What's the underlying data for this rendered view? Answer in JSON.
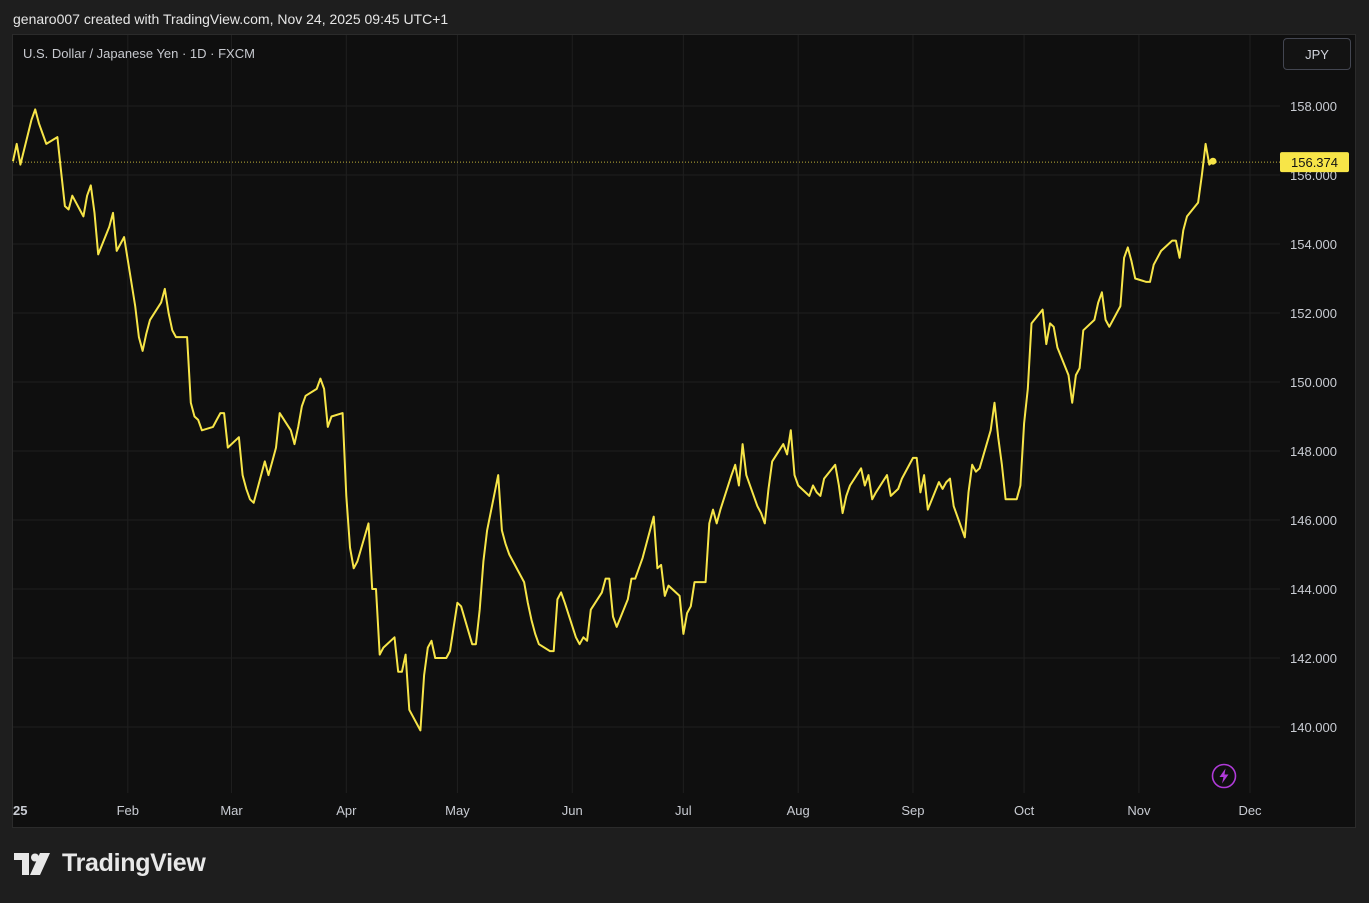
{
  "header": {
    "attribution": "genaro007 created with TradingView.com, Nov 24, 2025 09:45 UTC+1"
  },
  "toolbar": {
    "symbol_title": "U.S. Dollar / Japanese Yen · 1D · FXCM",
    "currency_button": "JPY"
  },
  "footer": {
    "logo_text": "TradingView",
    "logo_icon": "tradingview-logo-icon"
  },
  "icons": {
    "lightning": "lightning-icon"
  },
  "colors": {
    "line": "#f7e548",
    "background": "#0f0f0f",
    "outer_background": "#1e1e1e",
    "price_tag": "#f7e548",
    "lightning": "#b03bd9"
  },
  "chart_data": {
    "type": "line",
    "title": "",
    "xlabel": "",
    "ylabel": "",
    "ylim": [
      138.2,
      160.3
    ],
    "yticks": [
      "158.000",
      "156.000",
      "154.000",
      "152.000",
      "150.000",
      "148.000",
      "146.000",
      "144.000",
      "142.000",
      "140.000"
    ],
    "ytick_values": [
      158,
      156,
      154,
      152,
      150,
      148,
      146,
      144,
      142,
      140
    ],
    "xticks": [
      {
        "label": "25",
        "date": "2025-01-01",
        "bold": true
      },
      {
        "label": "Feb",
        "date": "2025-02-01"
      },
      {
        "label": "Mar",
        "date": "2025-03-01"
      },
      {
        "label": "Apr",
        "date": "2025-04-01"
      },
      {
        "label": "May",
        "date": "2025-05-01"
      },
      {
        "label": "Jun",
        "date": "2025-06-01"
      },
      {
        "label": "Jul",
        "date": "2025-07-01"
      },
      {
        "label": "Aug",
        "date": "2025-08-01"
      },
      {
        "label": "Sep",
        "date": "2025-09-01"
      },
      {
        "label": "Oct",
        "date": "2025-10-01"
      },
      {
        "label": "Nov",
        "date": "2025-11-01"
      },
      {
        "label": "Dec",
        "date": "2025-12-01"
      }
    ],
    "last_price": 156.374,
    "last_price_label": "156.374",
    "grid": true,
    "series": [
      {
        "values": [
          [
            "2025-01-01",
            156.4
          ],
          [
            "2025-01-02",
            156.9
          ],
          [
            "2025-01-03",
            156.3
          ],
          [
            "2025-01-06",
            157.6
          ],
          [
            "2025-01-07",
            157.9
          ],
          [
            "2025-01-08",
            157.5
          ],
          [
            "2025-01-09",
            157.2
          ],
          [
            "2025-01-10",
            156.9
          ],
          [
            "2025-01-13",
            157.1
          ],
          [
            "2025-01-14",
            156.1
          ],
          [
            "2025-01-15",
            155.1
          ],
          [
            "2025-01-16",
            155.0
          ],
          [
            "2025-01-17",
            155.4
          ],
          [
            "2025-01-20",
            154.8
          ],
          [
            "2025-01-21",
            155.4
          ],
          [
            "2025-01-22",
            155.7
          ],
          [
            "2025-01-23",
            154.9
          ],
          [
            "2025-01-24",
            153.7
          ],
          [
            "2025-01-27",
            154.5
          ],
          [
            "2025-01-28",
            154.9
          ],
          [
            "2025-01-29",
            153.8
          ],
          [
            "2025-01-30",
            154.0
          ],
          [
            "2025-01-31",
            154.2
          ],
          [
            "2025-02-03",
            152.2
          ],
          [
            "2025-02-04",
            151.3
          ],
          [
            "2025-02-05",
            150.9
          ],
          [
            "2025-02-06",
            151.4
          ],
          [
            "2025-02-07",
            151.8
          ],
          [
            "2025-02-10",
            152.3
          ],
          [
            "2025-02-11",
            152.7
          ],
          [
            "2025-02-12",
            152.0
          ],
          [
            "2025-02-13",
            151.5
          ],
          [
            "2025-02-14",
            151.3
          ],
          [
            "2025-02-17",
            151.3
          ],
          [
            "2025-02-18",
            149.4
          ],
          [
            "2025-02-19",
            149.0
          ],
          [
            "2025-02-20",
            148.9
          ],
          [
            "2025-02-21",
            148.6
          ],
          [
            "2025-02-24",
            148.7
          ],
          [
            "2025-02-25",
            148.9
          ],
          [
            "2025-02-26",
            149.1
          ],
          [
            "2025-02-27",
            149.1
          ],
          [
            "2025-02-28",
            148.1
          ],
          [
            "2025-03-03",
            148.4
          ],
          [
            "2025-03-04",
            147.3
          ],
          [
            "2025-03-05",
            146.9
          ],
          [
            "2025-03-06",
            146.6
          ],
          [
            "2025-03-07",
            146.5
          ],
          [
            "2025-03-10",
            147.7
          ],
          [
            "2025-03-11",
            147.3
          ],
          [
            "2025-03-12",
            147.7
          ],
          [
            "2025-03-13",
            148.1
          ],
          [
            "2025-03-14",
            149.1
          ],
          [
            "2025-03-17",
            148.6
          ],
          [
            "2025-03-18",
            148.2
          ],
          [
            "2025-03-19",
            148.7
          ],
          [
            "2025-03-20",
            149.3
          ],
          [
            "2025-03-21",
            149.6
          ],
          [
            "2025-03-24",
            149.8
          ],
          [
            "2025-03-25",
            150.1
          ],
          [
            "2025-03-26",
            149.8
          ],
          [
            "2025-03-27",
            148.7
          ],
          [
            "2025-03-28",
            149.0
          ],
          [
            "2025-03-31",
            149.1
          ],
          [
            "2025-04-01",
            146.7
          ],
          [
            "2025-04-02",
            145.2
          ],
          [
            "2025-04-03",
            144.6
          ],
          [
            "2025-04-04",
            144.8
          ],
          [
            "2025-04-07",
            145.9
          ],
          [
            "2025-04-08",
            144.0
          ],
          [
            "2025-04-09",
            144.0
          ],
          [
            "2025-04-10",
            142.1
          ],
          [
            "2025-04-11",
            142.3
          ],
          [
            "2025-04-14",
            142.6
          ],
          [
            "2025-04-15",
            141.6
          ],
          [
            "2025-04-16",
            141.6
          ],
          [
            "2025-04-17",
            142.1
          ],
          [
            "2025-04-18",
            140.5
          ],
          [
            "2025-04-21",
            139.9
          ],
          [
            "2025-04-22",
            141.5
          ],
          [
            "2025-04-23",
            142.3
          ],
          [
            "2025-04-24",
            142.5
          ],
          [
            "2025-04-25",
            142.0
          ],
          [
            "2025-04-28",
            142.0
          ],
          [
            "2025-04-29",
            142.2
          ],
          [
            "2025-04-30",
            142.9
          ],
          [
            "2025-05-01",
            143.6
          ],
          [
            "2025-05-02",
            143.5
          ],
          [
            "2025-05-05",
            142.4
          ],
          [
            "2025-05-06",
            142.4
          ],
          [
            "2025-05-07",
            143.4
          ],
          [
            "2025-05-08",
            144.8
          ],
          [
            "2025-05-09",
            145.7
          ],
          [
            "2025-05-12",
            147.3
          ],
          [
            "2025-05-13",
            145.7
          ],
          [
            "2025-05-14",
            145.3
          ],
          [
            "2025-05-15",
            145.0
          ],
          [
            "2025-05-16",
            144.8
          ],
          [
            "2025-05-19",
            144.2
          ],
          [
            "2025-05-20",
            143.6
          ],
          [
            "2025-05-21",
            143.1
          ],
          [
            "2025-05-22",
            142.7
          ],
          [
            "2025-05-23",
            142.4
          ],
          [
            "2025-05-26",
            142.2
          ],
          [
            "2025-05-27",
            142.2
          ],
          [
            "2025-05-28",
            143.7
          ],
          [
            "2025-05-29",
            143.9
          ],
          [
            "2025-05-30",
            143.6
          ],
          [
            "2025-06-02",
            142.6
          ],
          [
            "2025-06-03",
            142.4
          ],
          [
            "2025-06-04",
            142.6
          ],
          [
            "2025-06-05",
            142.5
          ],
          [
            "2025-06-06",
            143.4
          ],
          [
            "2025-06-09",
            143.9
          ],
          [
            "2025-06-10",
            144.3
          ],
          [
            "2025-06-11",
            144.3
          ],
          [
            "2025-06-12",
            143.2
          ],
          [
            "2025-06-13",
            142.9
          ],
          [
            "2025-06-16",
            143.7
          ],
          [
            "2025-06-17",
            144.3
          ],
          [
            "2025-06-18",
            144.3
          ],
          [
            "2025-06-19",
            144.6
          ],
          [
            "2025-06-20",
            144.9
          ],
          [
            "2025-06-23",
            146.1
          ],
          [
            "2025-06-24",
            144.6
          ],
          [
            "2025-06-25",
            144.7
          ],
          [
            "2025-06-26",
            143.8
          ],
          [
            "2025-06-27",
            144.1
          ],
          [
            "2025-06-30",
            143.8
          ],
          [
            "2025-07-01",
            142.7
          ],
          [
            "2025-07-02",
            143.3
          ],
          [
            "2025-07-03",
            143.5
          ],
          [
            "2025-07-04",
            144.2
          ],
          [
            "2025-07-07",
            144.2
          ],
          [
            "2025-07-08",
            145.9
          ],
          [
            "2025-07-09",
            146.3
          ],
          [
            "2025-07-10",
            145.9
          ],
          [
            "2025-07-11",
            146.3
          ],
          [
            "2025-07-14",
            147.3
          ],
          [
            "2025-07-15",
            147.6
          ],
          [
            "2025-07-16",
            147.0
          ],
          [
            "2025-07-17",
            148.2
          ],
          [
            "2025-07-18",
            147.3
          ],
          [
            "2025-07-21",
            146.4
          ],
          [
            "2025-07-22",
            146.2
          ],
          [
            "2025-07-23",
            145.9
          ],
          [
            "2025-07-24",
            146.9
          ],
          [
            "2025-07-25",
            147.7
          ],
          [
            "2025-07-28",
            148.2
          ],
          [
            "2025-07-29",
            147.9
          ],
          [
            "2025-07-30",
            148.6
          ],
          [
            "2025-07-31",
            147.3
          ],
          [
            "2025-08-01",
            147.0
          ],
          [
            "2025-08-04",
            146.7
          ],
          [
            "2025-08-05",
            147.0
          ],
          [
            "2025-08-06",
            146.8
          ],
          [
            "2025-08-07",
            146.7
          ],
          [
            "2025-08-08",
            147.2
          ],
          [
            "2025-08-11",
            147.6
          ],
          [
            "2025-08-12",
            147.0
          ],
          [
            "2025-08-13",
            146.2
          ],
          [
            "2025-08-14",
            146.7
          ],
          [
            "2025-08-15",
            147.0
          ],
          [
            "2025-08-18",
            147.5
          ],
          [
            "2025-08-19",
            147.0
          ],
          [
            "2025-08-20",
            147.3
          ],
          [
            "2025-08-21",
            146.6
          ],
          [
            "2025-08-22",
            146.8
          ],
          [
            "2025-08-25",
            147.3
          ],
          [
            "2025-08-26",
            146.7
          ],
          [
            "2025-08-27",
            146.8
          ],
          [
            "2025-08-28",
            146.9
          ],
          [
            "2025-08-29",
            147.2
          ],
          [
            "2025-09-01",
            147.8
          ],
          [
            "2025-09-02",
            147.8
          ],
          [
            "2025-09-03",
            146.8
          ],
          [
            "2025-09-04",
            147.3
          ],
          [
            "2025-09-05",
            146.3
          ],
          [
            "2025-09-08",
            147.1
          ],
          [
            "2025-09-09",
            146.9
          ],
          [
            "2025-09-10",
            147.1
          ],
          [
            "2025-09-11",
            147.2
          ],
          [
            "2025-09-12",
            146.4
          ],
          [
            "2025-09-15",
            145.5
          ],
          [
            "2025-09-16",
            146.8
          ],
          [
            "2025-09-17",
            147.6
          ],
          [
            "2025-09-18",
            147.4
          ],
          [
            "2025-09-19",
            147.5
          ],
          [
            "2025-09-22",
            148.6
          ],
          [
            "2025-09-23",
            149.4
          ],
          [
            "2025-09-24",
            148.4
          ],
          [
            "2025-09-25",
            147.6
          ],
          [
            "2025-09-26",
            146.6
          ],
          [
            "2025-09-29",
            146.6
          ],
          [
            "2025-09-30",
            147.0
          ],
          [
            "2025-10-01",
            148.8
          ],
          [
            "2025-10-02",
            149.8
          ],
          [
            "2025-10-03",
            151.7
          ],
          [
            "2025-10-06",
            152.1
          ],
          [
            "2025-10-07",
            151.1
          ],
          [
            "2025-10-08",
            151.7
          ],
          [
            "2025-10-09",
            151.6
          ],
          [
            "2025-10-10",
            151.0
          ],
          [
            "2025-10-13",
            150.2
          ],
          [
            "2025-10-14",
            149.4
          ],
          [
            "2025-10-15",
            150.2
          ],
          [
            "2025-10-16",
            150.4
          ],
          [
            "2025-10-17",
            151.5
          ],
          [
            "2025-10-20",
            151.8
          ],
          [
            "2025-10-21",
            152.3
          ],
          [
            "2025-10-22",
            152.6
          ],
          [
            "2025-10-23",
            151.8
          ],
          [
            "2025-10-24",
            151.6
          ],
          [
            "2025-10-27",
            152.2
          ],
          [
            "2025-10-28",
            153.6
          ],
          [
            "2025-10-29",
            153.9
          ],
          [
            "2025-10-30",
            153.5
          ],
          [
            "2025-10-31",
            153.0
          ],
          [
            "2025-11-03",
            152.9
          ],
          [
            "2025-11-04",
            152.9
          ],
          [
            "2025-11-05",
            153.4
          ],
          [
            "2025-11-06",
            153.6
          ],
          [
            "2025-11-07",
            153.8
          ],
          [
            "2025-11-10",
            154.1
          ],
          [
            "2025-11-11",
            154.1
          ],
          [
            "2025-11-12",
            153.6
          ],
          [
            "2025-11-13",
            154.4
          ],
          [
            "2025-11-14",
            154.8
          ],
          [
            "2025-11-17",
            155.2
          ],
          [
            "2025-11-18",
            156.0
          ],
          [
            "2025-11-19",
            156.9
          ],
          [
            "2025-11-20",
            156.3
          ],
          [
            "2025-11-21",
            156.4
          ]
        ]
      }
    ]
  }
}
